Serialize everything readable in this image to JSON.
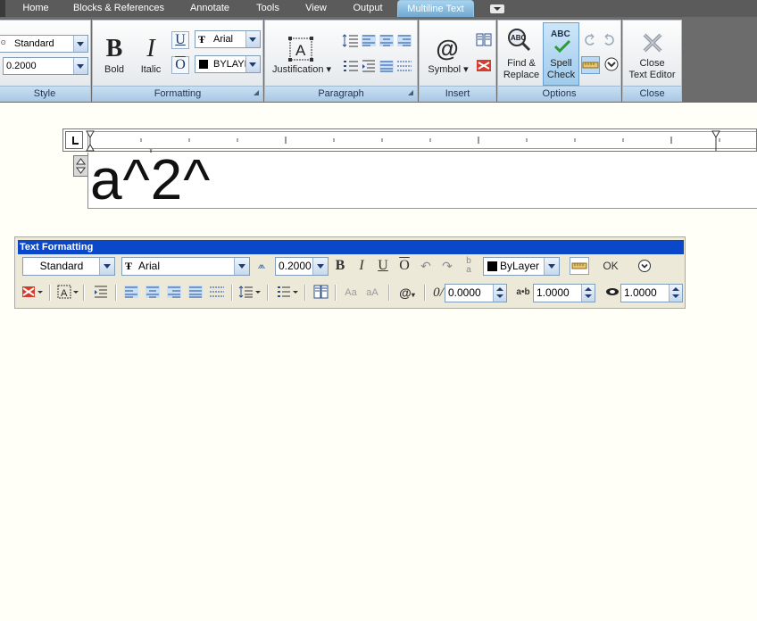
{
  "tabs": [
    {
      "label": "Home",
      "active": false
    },
    {
      "label": "Blocks & References",
      "active": false
    },
    {
      "label": "Annotate",
      "active": false
    },
    {
      "label": "Tools",
      "active": false
    },
    {
      "label": "View",
      "active": false
    },
    {
      "label": "Output",
      "active": false
    },
    {
      "label": "Multiline Text",
      "active": true
    }
  ],
  "ribbon": {
    "style": {
      "title": "Style",
      "style_value": "Standard",
      "height_value": "0.2000"
    },
    "formatting": {
      "title": "Formatting",
      "bold_label": "Bold",
      "italic_label": "Italic",
      "underline_glyph": "U",
      "overline_glyph": "O",
      "font_value": "Arial",
      "color_value": "BYLAYER"
    },
    "paragraph": {
      "title": "Paragraph",
      "justification_label": "Justification"
    },
    "insert": {
      "title": "Insert",
      "symbol_label": "Symbol"
    },
    "options": {
      "title": "Options",
      "find_label_1": "Find &",
      "find_label_2": "Replace",
      "spell_label_1": "Spell",
      "spell_label_2": "Check",
      "abc": "ABC"
    },
    "close": {
      "title": "Close",
      "label_1": "Close",
      "label_2": "Text Editor"
    }
  },
  "editor": {
    "text": "a^2^"
  },
  "text_formatting": {
    "title": "Text Formatting",
    "style_value": "Standard",
    "font_value": "Arial",
    "height_value": "0.2000",
    "color_value": "ByLayer",
    "ok_label": "OK",
    "oblique_value": "0.0000",
    "tracking_value": "1.0000",
    "width_value": "1.0000",
    "bold_glyph": "B",
    "italic_glyph": "I",
    "underline_glyph": "U",
    "overline_glyph": "O",
    "upper_glyph": "Aa",
    "lower_glyph": "aA"
  },
  "colors": {
    "active_tab": "#6fa8d0",
    "panel_title": "#a9c9e6",
    "toolbar_title": "#0a47c9",
    "toolbar_bg": "#ece9d8",
    "canvas_bg": "#fffff8"
  }
}
